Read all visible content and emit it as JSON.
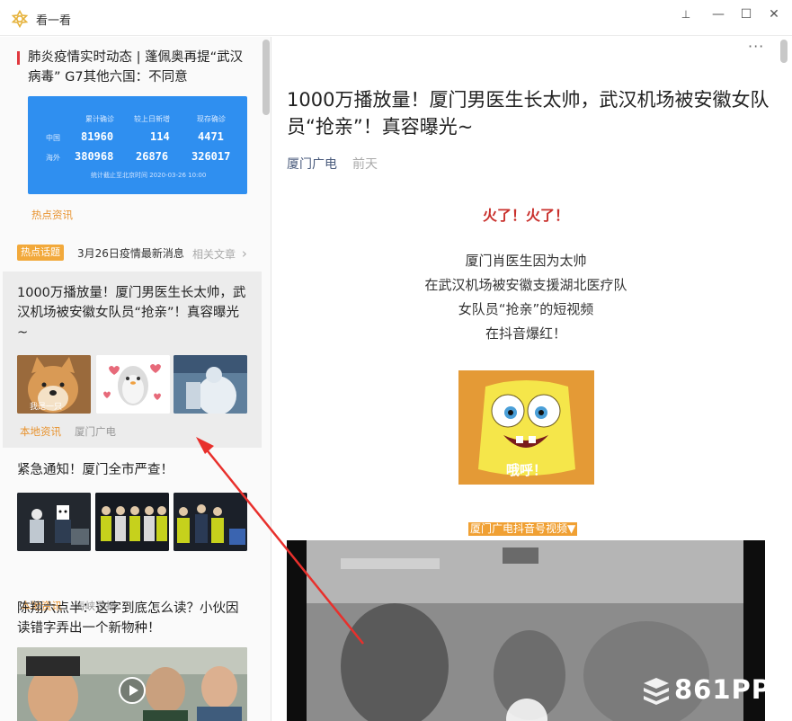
{
  "window": {
    "title": "看一看",
    "controls": {
      "pin": "⊥",
      "minimize": "—",
      "maximize": "☐",
      "close": "✕"
    }
  },
  "left": {
    "item1": {
      "title": "肺炎疫情实时动态 | 蓬佩奥再提“武汉病毒” G7其他六国：不同意",
      "tag": "热点资讯",
      "card": {
        "headers": [
          "累计确诊",
          "较上日新增",
          "现存确诊"
        ],
        "rows": [
          {
            "label": "中国",
            "values": [
              "81960",
              "114",
              "4471"
            ]
          },
          {
            "label": "海外",
            "values": [
              "380968",
              "26876",
              "326017"
            ]
          }
        ],
        "footnote": "统计截止至北京时间 2020-03-26 10:00"
      }
    },
    "hot": {
      "badge": "热点话题",
      "text": "3月26日疫情最新消息",
      "related": "相关文章",
      "chevron": "›"
    },
    "item2": {
      "title": "1000万播放量！厦门男医生长太帅，武汉机场被安徽女队员“抢亲”！真容曝光~",
      "tag": "本地资讯",
      "source": "厦门广电",
      "thumb1_caption": "我是一只"
    },
    "item3": {
      "title": "紧急通知！厦门全市严查！",
      "tag": "本地资讯",
      "source": "海峡导报"
    },
    "item4": {
      "title": "陈翔六点半：这字到底怎么读？小伙因读错字弄出一个新物种！"
    }
  },
  "article": {
    "more": "···",
    "title": "1000万播放量！厦门男医生长太帅，武汉机场被安徽女队员“抢亲”！真容曝光~",
    "source": "厦门广电",
    "time": "前天",
    "hot_line": "火了！火了！",
    "paragraphs": [
      "厦门肖医生因为太帅",
      "在武汉机场被安徽支援湖北医疗队",
      "女队员“抢亲”的短视频",
      "在抖音爆红！"
    ],
    "image_caption": "哦呼！",
    "video_label": "厦门广电抖音号视频▼"
  },
  "watermark": "861PPT",
  "colors": {
    "accent_red": "#e0383e",
    "tag_orange": "#e8932f",
    "covid_blue": "#2f8ff0",
    "badge_orange": "#f2a93b",
    "headline_red": "#c9302c"
  }
}
